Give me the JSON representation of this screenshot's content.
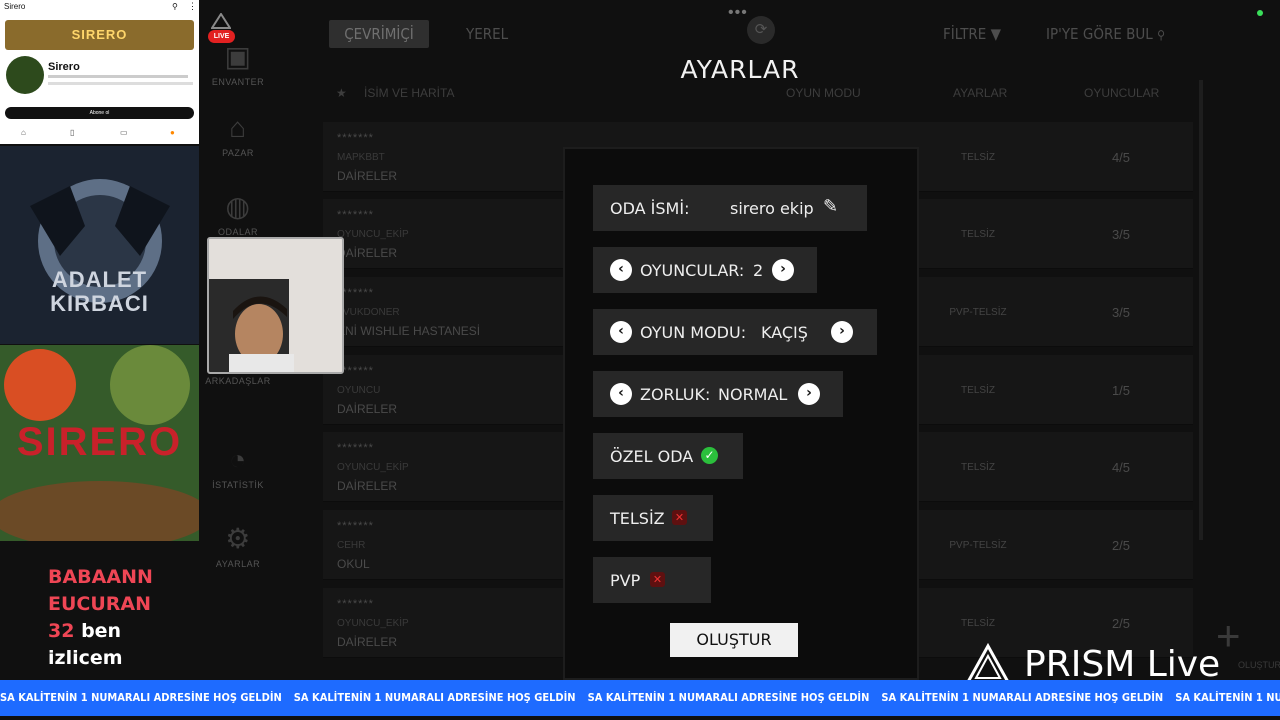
{
  "stream": {
    "live_badge": "LIVE",
    "prism_brand": "PRISM Live",
    "ticker_text": "SA KALİTENİN 1 NUMARALI ADRESİNE HOŞ GELDİN",
    "donation": {
      "line1": "BABAANN",
      "line2": "EUCURAN",
      "amount": "32",
      "line3_rest": " ben",
      "line4": "izlicem"
    },
    "youtube": {
      "window_title": "Sirero",
      "banner_text": "SIRERO",
      "channel_name": "Sirero",
      "subscribe_label": "Abone ol"
    },
    "logo_overlay": {
      "line1": "ADALET",
      "line2": "KIRBACI"
    },
    "art_overlay": {
      "title": "SIRERO"
    }
  },
  "game": {
    "tabs": {
      "online": "ÇEVRİMİÇİ",
      "local": "YEREL",
      "filter": "FİLTRE ▼",
      "ip_find": "IP'YE GÖRE BUL"
    },
    "sidebar": [
      {
        "label": "ENVANTER"
      },
      {
        "label": "PAZAR"
      },
      {
        "label": "ODALAR"
      },
      {
        "label": "ARKADAŞLAR"
      },
      {
        "label": "İSTATİSTİK"
      },
      {
        "label": "AYARLAR"
      }
    ],
    "columns": {
      "name": "İSİM VE HARİTA",
      "mode": "OYUN MODU",
      "settings": "AYARLAR",
      "players": "OYUNCULAR"
    },
    "rooms": [
      {
        "stars": "*******",
        "owner": "MAPKBBT",
        "map": "DAİRELER",
        "settings": "TELSİZ",
        "players": "4/5"
      },
      {
        "stars": "*******",
        "owner": "OYUNCU_EKİP",
        "map": "DAİRELER",
        "settings": "TELSİZ",
        "players": "3/5"
      },
      {
        "stars": "*******",
        "owner": "AVUKDONER",
        "map": "ENİ WISHLIE HASTANESİ",
        "settings": "PVP-TELSİZ",
        "players": "3/5"
      },
      {
        "stars": "*******",
        "owner": "OYUNCU",
        "map": "DAİRELER",
        "settings": "TELSİZ",
        "players": "1/5"
      },
      {
        "stars": "*******",
        "owner": "OYUNCU_EKİP",
        "map": "DAİRELER",
        "settings": "TELSİZ",
        "players": "4/5"
      },
      {
        "stars": "*******",
        "owner": "CEHR",
        "map": "OKUL",
        "settings": "PVP-TELSİZ",
        "players": "2/5"
      },
      {
        "stars": "*******",
        "owner": "OYUNCU_EKİP",
        "map": "DAİRELER",
        "settings": "TELSİZ",
        "players": "2/5"
      }
    ],
    "create_corner": "OLUŞTUR"
  },
  "settings_dialog": {
    "title": "AYARLAR",
    "room_name_label": "ODA İSMİ:",
    "room_name_value": "sirero ekip",
    "players_label": "OYUNCULAR:",
    "players_value": "2",
    "mode_label": "OYUN MODU:",
    "mode_value": "KAÇIŞ",
    "difficulty_label": "ZORLUK:",
    "difficulty_value": "NORMAL",
    "private_label": "ÖZEL ODA",
    "private_enabled": true,
    "radio_label": "TELSİZ",
    "radio_enabled": false,
    "pvp_label": "PVP",
    "pvp_enabled": false,
    "create_label": "OLUŞTUR"
  }
}
